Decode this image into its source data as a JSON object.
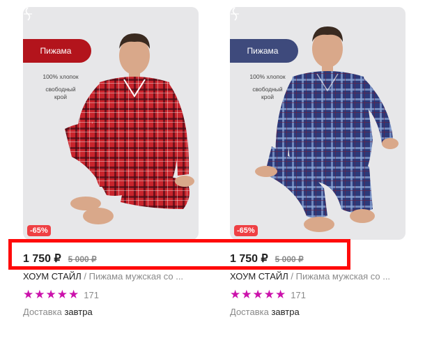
{
  "products": [
    {
      "tag": "Пижама",
      "tag_color": "#b3141c",
      "features": [
        "100% хлопок",
        "свободный",
        "крой"
      ],
      "discount": "-65%",
      "price": "1 750 ₽",
      "old_price": "5 000 ₽",
      "brand": "ХОУМ СТАЙЛ",
      "separator": " / ",
      "name": "Пижама мужская со ...",
      "rating_count": "171",
      "delivery_label": "Доставка",
      "delivery_when": "завтра",
      "pajama_color": "#c8242c",
      "plaid_color": "#4a0a16"
    },
    {
      "tag": "Пижама",
      "tag_color": "#3e4a7c",
      "features": [
        "100% хлопок",
        "свободный",
        "крой"
      ],
      "discount": "-65%",
      "price": "1 750 ₽",
      "old_price": "5 000 ₽",
      "brand": "ХОУМ СТАЙЛ",
      "separator": " / ",
      "name": "Пижама мужская со ...",
      "rating_count": "171",
      "delivery_label": "Доставка",
      "delivery_when": "завтра",
      "pajama_color": "#2c3a7a",
      "plaid_color": "#8ea8d8"
    }
  ],
  "star_glyph": "★",
  "highlight_color": "#ff0a0a",
  "accent_star_color": "#cb11ab",
  "discount_color": "#ef4044"
}
